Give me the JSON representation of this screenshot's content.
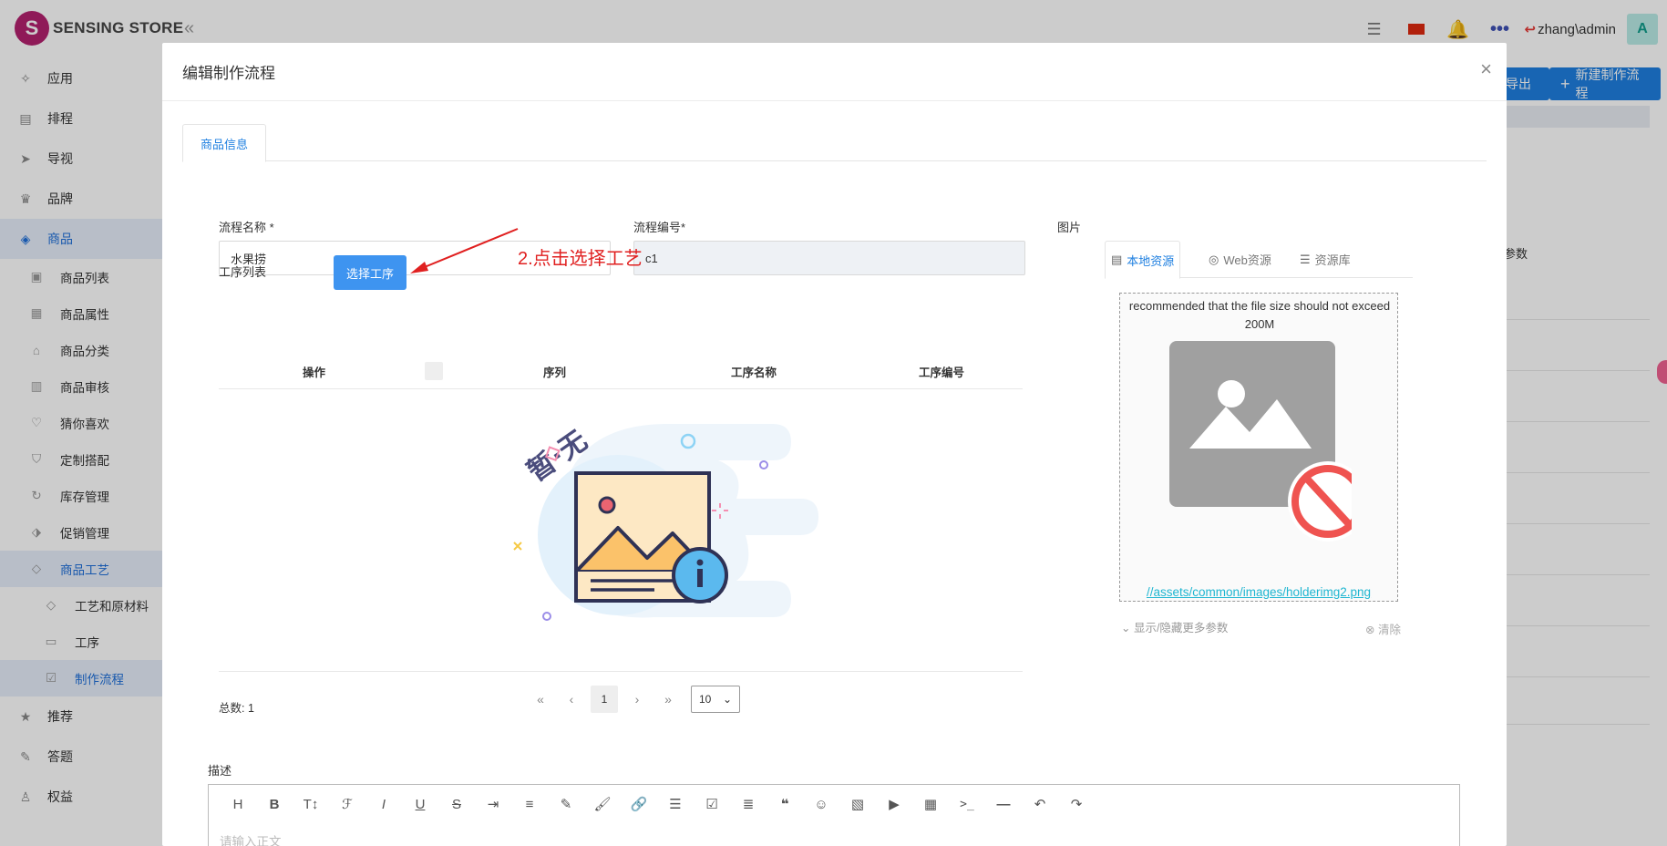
{
  "app": {
    "logo_letter": "S",
    "name": "SENSING STORE",
    "user": "zhang\\admin",
    "avatar_letter": "A"
  },
  "sidebar": {
    "items": [
      {
        "label": "应用",
        "icon": "apps-icon"
      },
      {
        "label": "排程",
        "icon": "schedule-icon"
      },
      {
        "label": "导视",
        "icon": "guide-icon"
      },
      {
        "label": "品牌",
        "icon": "crown-icon"
      },
      {
        "label": "商品",
        "icon": "cube-icon"
      }
    ],
    "product_subitems": [
      {
        "label": "商品列表"
      },
      {
        "label": "商品属性"
      },
      {
        "label": "商品分类"
      },
      {
        "label": "商品审核"
      },
      {
        "label": "猜你喜欢"
      },
      {
        "label": "定制搭配"
      },
      {
        "label": "库存管理"
      },
      {
        "label": "促销管理"
      },
      {
        "label": "商品工艺"
      }
    ],
    "craft_subitems": [
      {
        "label": "工艺和原材料"
      },
      {
        "label": "工序"
      },
      {
        "label": "制作流程"
      }
    ],
    "bottom_items": [
      {
        "label": "推荐"
      },
      {
        "label": "答题"
      },
      {
        "label": "权益"
      }
    ]
  },
  "background": {
    "export_label": "导出",
    "new_flow_label": "新建制作流程",
    "column_label": "参数"
  },
  "modal": {
    "title": "编辑制作流程",
    "close": "×",
    "tab": "商品信息",
    "name_label": "流程名称 *",
    "name_value": "水果捞",
    "code_label": "流程编号*",
    "code_value": "c1",
    "process_list_label": "工序列表",
    "select_process_button": "选择工序",
    "annotation": "2.点击选择工艺",
    "table_headers": [
      "操作",
      "序列",
      "工序名称",
      "工序编号"
    ],
    "empty_text": "暂·无",
    "total": "总数: 1",
    "pagination": {
      "current_page": "1",
      "page_size": "10"
    },
    "image_label": "图片",
    "image_tabs": [
      "本地资源",
      "Web资源",
      "资源库"
    ],
    "upload_hint": "recommended that the file size should not exceed 200M",
    "image_path": "//assets/common/images/holderimg2.png",
    "toggle_params": "显示/隐藏更多参数",
    "clear": "清除",
    "description_label": "描述",
    "editor_placeholder": "请输入正文"
  },
  "colors": {
    "primary": "#1e7fe0",
    "annotation": "#e02020",
    "path_link": "#1fb6d1"
  }
}
